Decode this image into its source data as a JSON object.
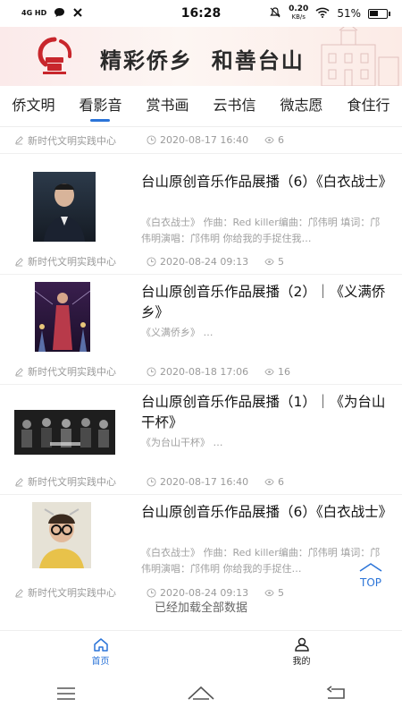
{
  "status_bar": {
    "network": "4G HD",
    "time": "16:28",
    "speed_value": "0.20",
    "speed_unit": "KB/s",
    "battery": "51%",
    "battery_level": 0.51
  },
  "banner": {
    "slogan": "精彩侨乡  和善台山"
  },
  "tabs": [
    {
      "label": "侨文明",
      "active": false
    },
    {
      "label": "看影音",
      "active": true
    },
    {
      "label": "赏书画",
      "active": false
    },
    {
      "label": "云书信",
      "active": false
    },
    {
      "label": "微志愿",
      "active": false
    },
    {
      "label": "食住行",
      "active": false
    }
  ],
  "top_meta": {
    "source": "新时代文明实践中心",
    "date": "2020-08-17 16:40",
    "views": "6"
  },
  "items": [
    {
      "title": "台山原创音乐作品展播（6）《白衣战士》",
      "desc": "《白衣战士》 作曲：Red killer编曲：邝伟明 填词：邝伟明演唱：邝伟明 你给我的手捉住我…",
      "source": "新时代文明实践中心",
      "date": "2020-08-24 09:13",
      "views": "5"
    },
    {
      "title": "台山原创音乐作品展播（2）｜《义满侨乡》",
      "desc": "《义满侨乡》 …",
      "source": "新时代文明实践中心",
      "date": "2020-08-18 17:06",
      "views": "16"
    },
    {
      "title": "台山原创音乐作品展播（1）｜《为台山干杯》",
      "desc": "《为台山干杯》 …",
      "source": "新时代文明实践中心",
      "date": "2020-08-17 16:40",
      "views": "6"
    },
    {
      "title": "台山原创音乐作品展播（6）《白衣战士》",
      "desc": "《白衣战士》 作曲：Red killer编曲：邝伟明 填词：邝伟明演唱：邝伟明 你给我的手捉住…",
      "source": "新时代文明实践中心",
      "date": "2020-08-24 09:13",
      "views": "5"
    }
  ],
  "end_text": "已经加载全部数据",
  "top_button": "TOP",
  "bottom_nav": [
    {
      "label": "首页",
      "icon": "home-icon",
      "active": true
    },
    {
      "label": "我的",
      "icon": "user-icon",
      "active": false
    }
  ],
  "colors": {
    "accent": "#2b74d8",
    "meta_gray": "#9a9a9a",
    "brand_red": "#c8262c"
  }
}
